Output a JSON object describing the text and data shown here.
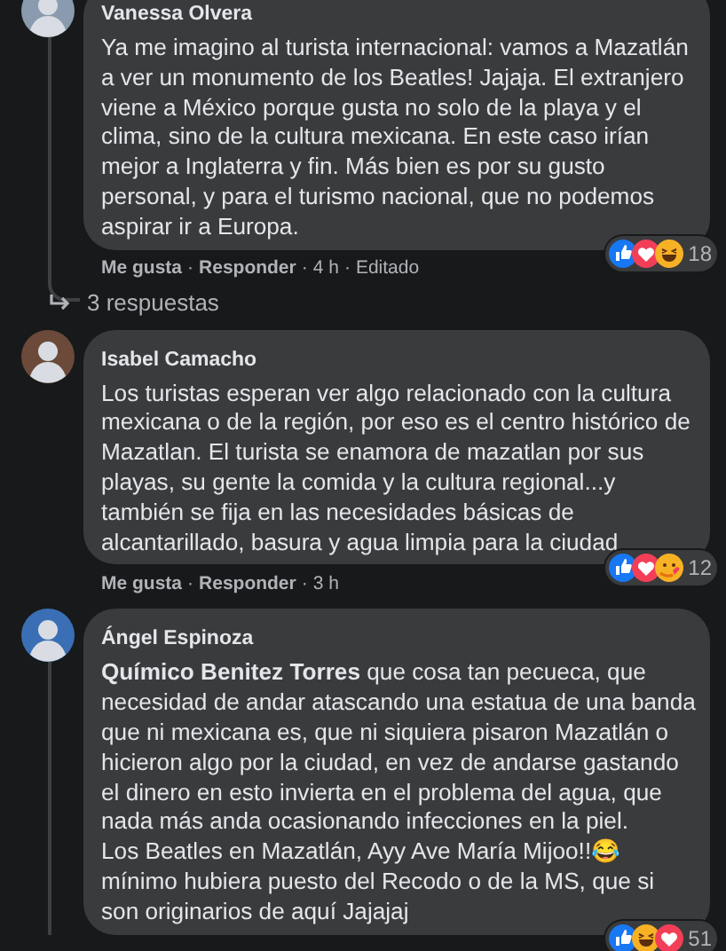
{
  "comments": [
    {
      "author": "Vanessa Olvera",
      "text": "Ya me imagino al turista internacional: vamos a Mazatlán a ver un monumento de los Beatles! Jajaja. El extranjero viene a México porque gusta no solo de la playa y el clima, sino de la cultura mexicana. En este caso irían mejor a Inglaterra y fin. Más bien es por su gusto personal, y para el turismo nacional, que no podemos aspirar ir a Europa.",
      "reactions": [
        {
          "kind": "like"
        },
        {
          "kind": "love"
        },
        {
          "kind": "haha"
        }
      ],
      "reaction_count": "18",
      "meta": [
        {
          "kind": "action",
          "text": "Me gusta"
        },
        {
          "kind": "sep",
          "text": "·"
        },
        {
          "kind": "action",
          "text": "Responder"
        },
        {
          "kind": "sep",
          "text": "·"
        },
        {
          "kind": "info",
          "text": "4 h"
        },
        {
          "kind": "sep",
          "text": "·"
        },
        {
          "kind": "info",
          "text": "Editado"
        }
      ],
      "thread": true,
      "replies": "3 respuestas"
    },
    {
      "author": "Isabel Camacho",
      "text": "Los turistas esperan ver algo relacionado con la cultura mexicana o de la región, por eso es el centro histórico de Mazatlan. El turista se enamora de mazatlan por sus playas, su gente la comida y la cultura regional...y también se fija en las necesidades básicas de alcantarillado, basura y agua limpia para la ciudad",
      "reactions": [
        {
          "kind": "like"
        },
        {
          "kind": "love"
        },
        {
          "kind": "care"
        }
      ],
      "reaction_count": "12",
      "meta": [
        {
          "kind": "action",
          "text": "Me gusta"
        },
        {
          "kind": "sep",
          "text": "·"
        },
        {
          "kind": "action",
          "text": "Responder"
        },
        {
          "kind": "sep",
          "text": "·"
        },
        {
          "kind": "info",
          "text": "3 h"
        }
      ],
      "thread": false
    },
    {
      "author": "Ángel Espinoza",
      "text": "**Químico Benitez Torres** que cosa tan pecueca, que necesidad de andar atascando una estatua de una banda que ni mexicana es, que ni siquiera pisaron Mazatlán o hicieron algo por la ciudad, en vez de andarse gastando el dinero en esto invierta en el problema del agua, que nada más anda ocasionando infecciones en la piel.\nLos Beatles en Mazatlán, Ayy Ave María Mijoo!!😂 mínimo hubiera puesto del Recodo o de la MS, que si son originarios de aquí Jajajaj",
      "reactions": [
        {
          "kind": "like"
        },
        {
          "kind": "haha"
        },
        {
          "kind": "love"
        }
      ],
      "reaction_count": "51",
      "thread": true
    }
  ]
}
